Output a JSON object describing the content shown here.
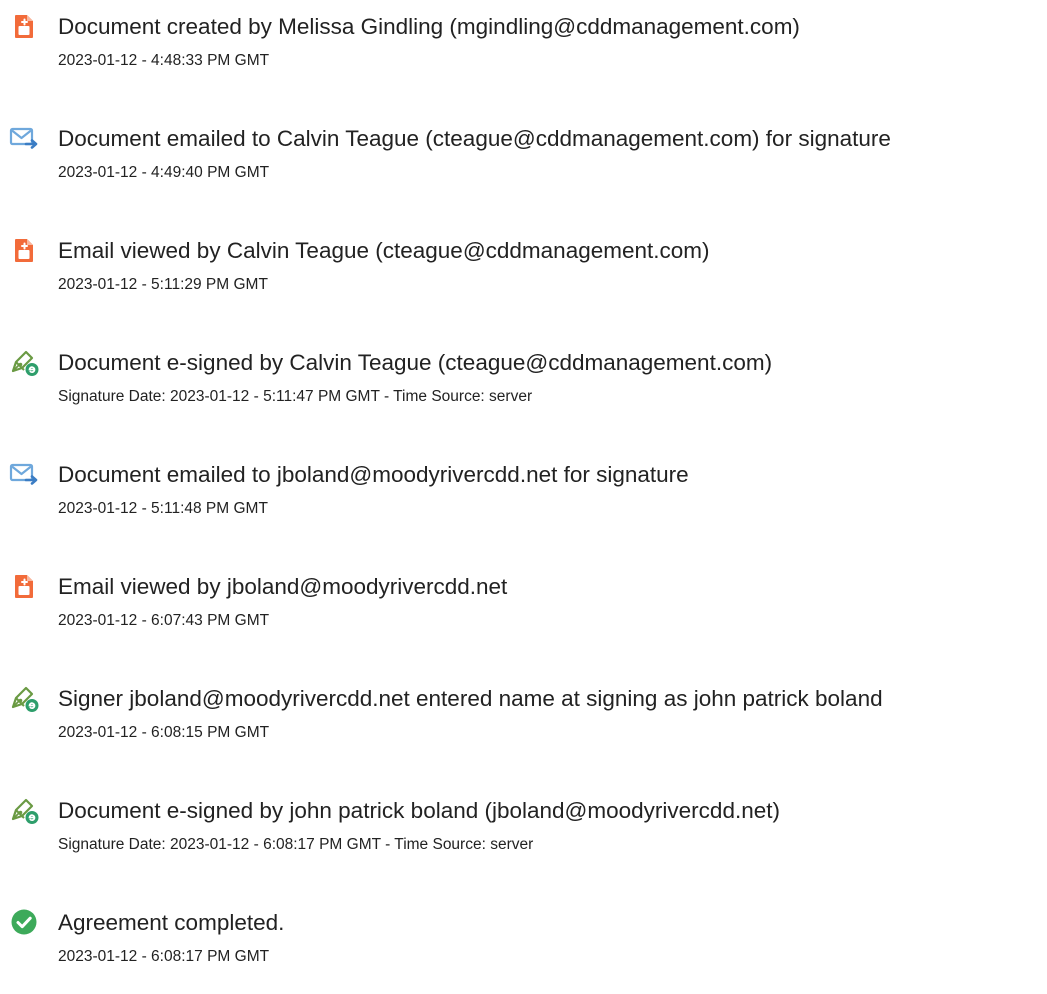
{
  "colors": {
    "created_icon": "#F26B3A",
    "email_icon": "#6FA8DC",
    "esign_pen": "#6A9A43",
    "esign_badge": "#2E9E6B",
    "completed_icon": "#3DAA5A"
  },
  "events": [
    {
      "icon": "document-created-icon",
      "title": "Document created by Melissa Gindling (mgindling@cddmanagement.com)",
      "detail": "2023-01-12 - 4:48:33 PM GMT"
    },
    {
      "icon": "email-sent-icon",
      "title": "Document emailed to Calvin Teague (cteague@cddmanagement.com) for signature",
      "detail": "2023-01-12 - 4:49:40 PM GMT"
    },
    {
      "icon": "document-viewed-icon",
      "title": "Email viewed by Calvin Teague (cteague@cddmanagement.com)",
      "detail": "2023-01-12 - 5:11:29 PM GMT"
    },
    {
      "icon": "e-sign-icon",
      "title": "Document e-signed by Calvin Teague (cteague@cddmanagement.com)",
      "detail": "Signature Date: 2023-01-12 - 5:11:47 PM GMT - Time Source: server"
    },
    {
      "icon": "email-sent-icon",
      "title": "Document emailed to jboland@moodyrivercdd.net for signature",
      "detail": "2023-01-12 - 5:11:48 PM GMT"
    },
    {
      "icon": "document-viewed-icon",
      "title": "Email viewed by jboland@moodyrivercdd.net",
      "detail": "2023-01-12 - 6:07:43 PM GMT"
    },
    {
      "icon": "e-sign-icon",
      "title": "Signer jboland@moodyrivercdd.net entered name at signing as john patrick boland",
      "detail": "2023-01-12 - 6:08:15 PM GMT"
    },
    {
      "icon": "e-sign-icon",
      "title": "Document e-signed by john patrick boland (jboland@moodyrivercdd.net)",
      "detail": "Signature Date: 2023-01-12 - 6:08:17 PM GMT - Time Source: server"
    },
    {
      "icon": "checkmark-icon",
      "title": "Agreement completed.",
      "detail": "2023-01-12 - 6:08:17 PM GMT"
    }
  ]
}
